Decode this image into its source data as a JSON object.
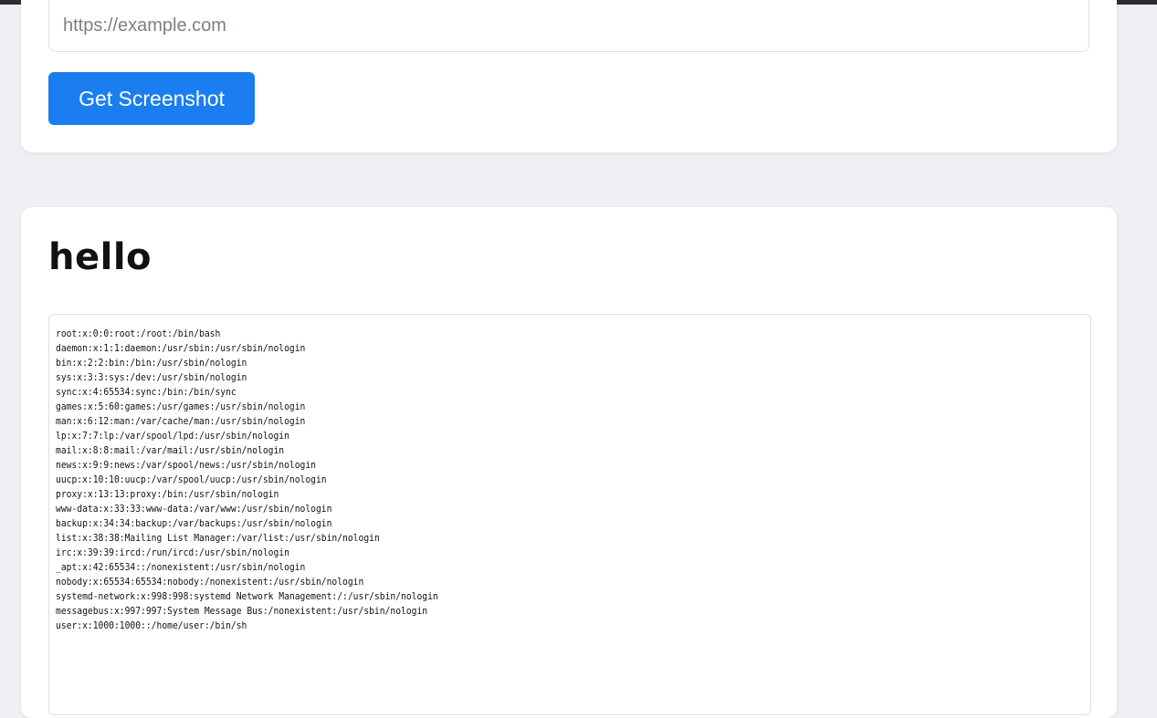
{
  "form": {
    "url_placeholder": "https://example.com",
    "url_value": "",
    "submit_label": "Get Screenshot"
  },
  "result": {
    "title": "hello",
    "lines": [
      "root:x:0:0:root:/root:/bin/bash",
      "daemon:x:1:1:daemon:/usr/sbin:/usr/sbin/nologin",
      "bin:x:2:2:bin:/bin:/usr/sbin/nologin",
      "sys:x:3:3:sys:/dev:/usr/sbin/nologin",
      "sync:x:4:65534:sync:/bin:/bin/sync",
      "games:x:5:60:games:/usr/games:/usr/sbin/nologin",
      "man:x:6:12:man:/var/cache/man:/usr/sbin/nologin",
      "lp:x:7:7:lp:/var/spool/lpd:/usr/sbin/nologin",
      "mail:x:8:8:mail:/var/mail:/usr/sbin/nologin",
      "news:x:9:9:news:/var/spool/news:/usr/sbin/nologin",
      "uucp:x:10:10:uucp:/var/spool/uucp:/usr/sbin/nologin",
      "proxy:x:13:13:proxy:/bin:/usr/sbin/nologin",
      "www-data:x:33:33:www-data:/var/www:/usr/sbin/nologin",
      "backup:x:34:34:backup:/var/backups:/usr/sbin/nologin",
      "list:x:38:38:Mailing List Manager:/var/list:/usr/sbin/nologin",
      "irc:x:39:39:ircd:/run/ircd:/usr/sbin/nologin",
      "_apt:x:42:65534::/nonexistent:/usr/sbin/nologin",
      "nobody:x:65534:65534:nobody:/nonexistent:/usr/sbin/nologin",
      "systemd-network:x:998:998:systemd Network Management:/:/usr/sbin/nologin",
      "messagebus:x:997:997:System Message Bus:/nonexistent:/usr/sbin/nologin",
      "user:x:1000:1000::/home/user:/bin/sh"
    ]
  },
  "colors": {
    "page_background": "#eef0f4",
    "button_primary": "#1a7ef0",
    "card_background": "#ffffff"
  }
}
